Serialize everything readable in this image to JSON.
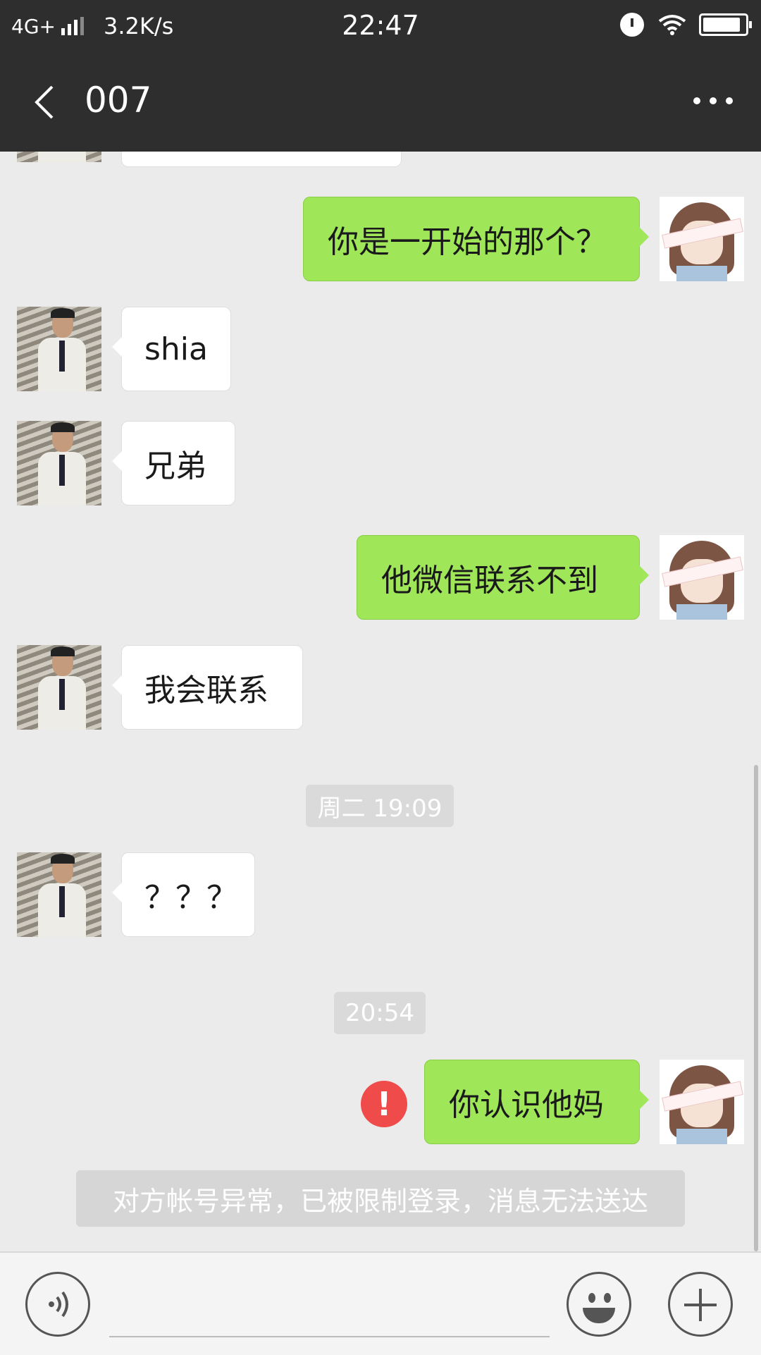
{
  "status_bar": {
    "network": "4G+",
    "speed": "3.2K/s",
    "time": "22:47"
  },
  "header": {
    "title": "007"
  },
  "chat": {
    "partial_top_message": "",
    "messages": [
      {
        "side": "out",
        "text": "你是一开始的那个？"
      },
      {
        "side": "in",
        "text": "shia"
      },
      {
        "side": "in",
        "text": "兄弟"
      },
      {
        "side": "out",
        "text": "他微信联系不到"
      },
      {
        "side": "in",
        "text": "我会联系"
      },
      {
        "type": "time",
        "text": "周二 19:09"
      },
      {
        "side": "in",
        "text": "？？？"
      },
      {
        "type": "time",
        "text": "20:54"
      },
      {
        "side": "out",
        "text": "你认识他妈",
        "status": "failed"
      }
    ],
    "system_notice": "对方帐号异常，已被限制登录，消息无法送达"
  },
  "icons": {
    "back": "back-arrow-icon",
    "more": "more-icon",
    "alarm": "alarm-icon",
    "wifi": "wifi-icon",
    "battery": "battery-icon",
    "error": "error-icon",
    "voice": "voice-icon",
    "emoji": "emoji-icon",
    "plus": "plus-icon"
  },
  "colors": {
    "header_bg": "#2e2e2e",
    "chat_bg": "#ebebeb",
    "outgoing_bubble": "#9fe658",
    "incoming_bubble": "#ffffff",
    "error_red": "#f04b4b"
  }
}
